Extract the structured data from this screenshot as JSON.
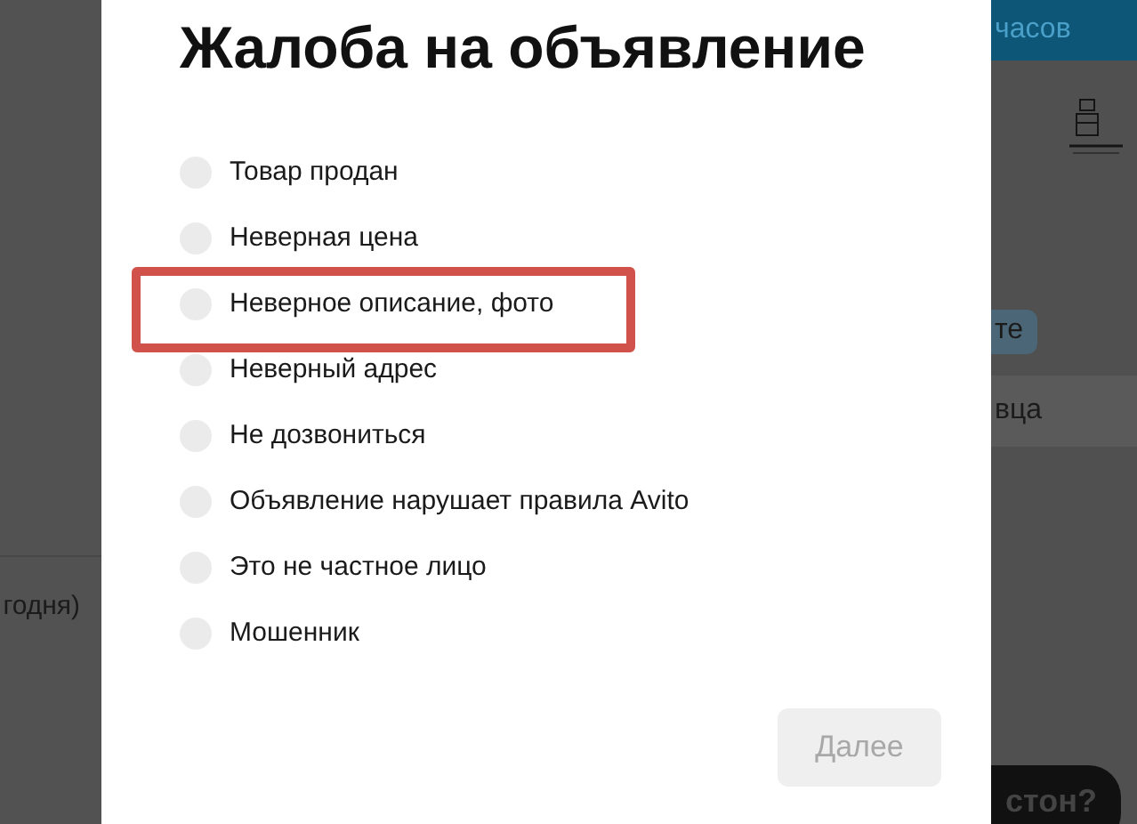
{
  "background": {
    "left_text": "годня)",
    "header_text": "часов",
    "chip_text": "те",
    "band_text": "вца",
    "bottom_button": "стон?"
  },
  "dialog": {
    "title": "Жалоба на объявление",
    "options": [
      {
        "label": "Товар продан",
        "selected": false,
        "highlighted": false
      },
      {
        "label": "Неверная цена",
        "selected": false,
        "highlighted": false
      },
      {
        "label": "Неверное описание, фото",
        "selected": false,
        "highlighted": true
      },
      {
        "label": "Неверный адрес",
        "selected": false,
        "highlighted": false
      },
      {
        "label": "Не дозвониться",
        "selected": false,
        "highlighted": false
      },
      {
        "label": "Объявление нарушает правила Avito",
        "selected": false,
        "highlighted": false
      },
      {
        "label": "Это не частное лицо",
        "selected": false,
        "highlighted": false
      },
      {
        "label": "Мошенник",
        "selected": false,
        "highlighted": false
      }
    ],
    "next_button": {
      "label": "Далее",
      "disabled": true
    }
  }
}
